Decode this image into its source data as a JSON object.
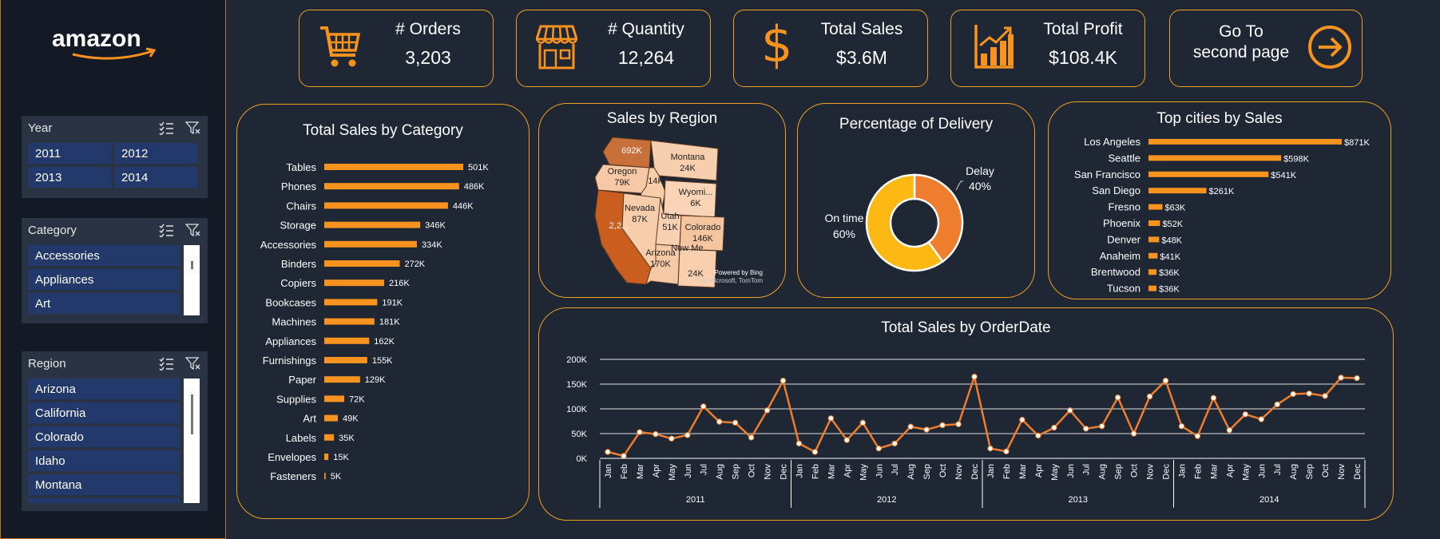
{
  "brand": {
    "logo_text": "amazon"
  },
  "kpis": [
    {
      "label": "# Orders",
      "value": "3,203",
      "icon": "shopping-cart-icon"
    },
    {
      "label": "# Quantity",
      "value": "12,264",
      "icon": "storefront-icon"
    },
    {
      "label": "Total Sales",
      "value": "$3.6M",
      "icon": "dollar-icon"
    },
    {
      "label": "Total Profit",
      "value": "$108.4K",
      "icon": "bar-growth-icon"
    }
  ],
  "nav": {
    "line1": "Go To",
    "line2": "second page",
    "icon": "arrow-right-circle-icon"
  },
  "filters": {
    "year": {
      "title": "Year",
      "options": [
        "2011",
        "2012",
        "2013",
        "2014"
      ]
    },
    "category": {
      "title": "Category",
      "options": [
        "Accessories",
        "Appliances",
        "Art"
      ]
    },
    "region": {
      "title": "Region",
      "options": [
        "Arizona",
        "California",
        "Colorado",
        "Idaho",
        "Montana"
      ]
    }
  },
  "colors": {
    "accent": "#f7931e",
    "panel_border": "#f0a020",
    "background": "#1f2634",
    "sidebar": "#141a25",
    "chip": "#23396b"
  },
  "chart_data": [
    {
      "type": "bar",
      "orientation": "horizontal",
      "title": "Total Sales by Category",
      "categories": [
        "Tables",
        "Phones",
        "Chairs",
        "Storage",
        "Accessories",
        "Binders",
        "Copiers",
        "Bookcases",
        "Machines",
        "Appliances",
        "Furnishings",
        "Paper",
        "Supplies",
        "Art",
        "Labels",
        "Envelopes",
        "Fasteners"
      ],
      "values": [
        501,
        486,
        446,
        346,
        334,
        272,
        216,
        191,
        181,
        162,
        155,
        129,
        72,
        49,
        35,
        15,
        5
      ],
      "labels": [
        "501K",
        "486K",
        "446K",
        "346K",
        "334K",
        "272K",
        "216K",
        "191K",
        "181K",
        "162K",
        "155K",
        "129K",
        "72K",
        "49K",
        "35K",
        "15K",
        "5K"
      ],
      "unit": "K"
    },
    {
      "type": "map",
      "title": "Sales by Region",
      "regions": [
        {
          "name": "Washington",
          "label": "692K"
        },
        {
          "name": "Oregon",
          "label": "Oregon",
          "value": "79K"
        },
        {
          "name": "Montana",
          "label": "Montana",
          "value": "24K"
        },
        {
          "name": "Idaho",
          "label": "14K"
        },
        {
          "name": "Wyoming",
          "label": "Wyomi...",
          "value": "6K"
        },
        {
          "name": "California",
          "label": "2,2..."
        },
        {
          "name": "Nevada",
          "label": "Nevada",
          "value": "87K"
        },
        {
          "name": "Utah",
          "label": "Utah",
          "value": "51K"
        },
        {
          "name": "Colorado",
          "label": "Colorado",
          "value": "146K"
        },
        {
          "name": "Arizona",
          "label": "Arizona",
          "value": "170K"
        },
        {
          "name": "New Mexico",
          "label": "New Me...",
          "value": "24K"
        }
      ],
      "credit1": "Powered by Bing",
      "credit2": "© Microsoft, TomTom"
    },
    {
      "type": "pie",
      "title": "Percentage of Delivery",
      "slices": [
        {
          "name": "Delay",
          "value": 40,
          "label": "40%",
          "color": "#ef7d2e"
        },
        {
          "name": "On time",
          "value": 60,
          "label": "60%",
          "color": "#fdb813"
        }
      ]
    },
    {
      "type": "bar",
      "orientation": "horizontal",
      "title": "Top cities by Sales",
      "categories": [
        "Los Angeles",
        "Seattle",
        "San Francisco",
        "San Diego",
        "Fresno",
        "Phoenix",
        "Denver",
        "Anaheim",
        "Brentwood",
        "Tucson"
      ],
      "values": [
        871,
        598,
        541,
        261,
        63,
        52,
        48,
        41,
        36,
        36
      ],
      "labels": [
        "$871K",
        "$598K",
        "$541K",
        "$261K",
        "$63K",
        "$52K",
        "$48K",
        "$41K",
        "$36K",
        "$36K"
      ],
      "unit": "K"
    },
    {
      "type": "line",
      "title": "Total Sales by OrderDate",
      "years": [
        "2011",
        "2012",
        "2013",
        "2014"
      ],
      "months": [
        "Jan",
        "Feb",
        "Mar",
        "Apr",
        "May",
        "Jun",
        "Jul",
        "Aug",
        "Sep",
        "Oct",
        "Nov",
        "Dec"
      ],
      "values": [
        13,
        5,
        53,
        49,
        40,
        47,
        105,
        74,
        72,
        42,
        97,
        157,
        30,
        13,
        81,
        37,
        72,
        20,
        30,
        64,
        58,
        67,
        69,
        165,
        20,
        14,
        78,
        46,
        62,
        97,
        60,
        65,
        123,
        50,
        125,
        157,
        65,
        45,
        122,
        57,
        89,
        79,
        109,
        130,
        131,
        126,
        163,
        162
      ],
      "ylim": [
        0,
        200
      ],
      "yticks": [
        "0K",
        "50K",
        "100K",
        "150K",
        "200K"
      ],
      "unit": "K"
    }
  ]
}
